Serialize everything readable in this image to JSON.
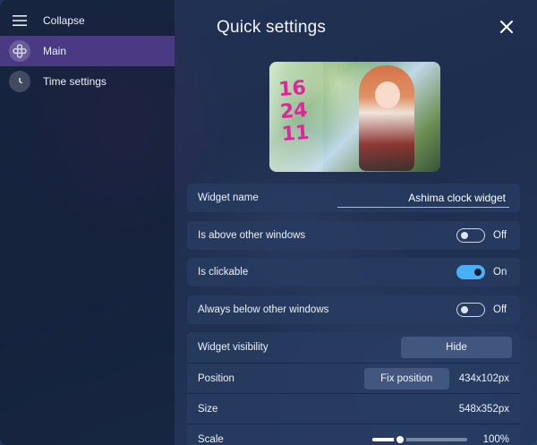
{
  "sidebar": {
    "items": [
      {
        "label": "Collapse",
        "icon": "hamburger-menu-icon"
      },
      {
        "label": "Main",
        "icon": "widget-nodes-icon",
        "active": true
      },
      {
        "label": "Time settings",
        "icon": "clock-icon"
      }
    ]
  },
  "header": {
    "title": "Quick settings",
    "close_icon": "close-icon"
  },
  "preview": {
    "clock_text": [
      "16",
      "24",
      "11"
    ],
    "accent_color": "#e0259c"
  },
  "settings": {
    "widget_name": {
      "label": "Widget name",
      "value": "Ashima clock widget"
    },
    "above": {
      "label": "Is above other windows",
      "state": "Off",
      "on": false
    },
    "clickable": {
      "label": "Is clickable",
      "state": "On",
      "on": true
    },
    "below": {
      "label": "Always below other windows",
      "state": "Off",
      "on": false
    },
    "visibility": {
      "label": "Widget visibility",
      "button": "Hide"
    },
    "position": {
      "label": "Position",
      "button": "Fix position",
      "value": "434x102px"
    },
    "size": {
      "label": "Size",
      "value": "548x352px"
    },
    "scale": {
      "label": "Scale",
      "value": "100%",
      "level": 0.3
    }
  },
  "colors": {
    "active_nav": "#4a3a84",
    "toggle_on": "#4ab0f5"
  }
}
